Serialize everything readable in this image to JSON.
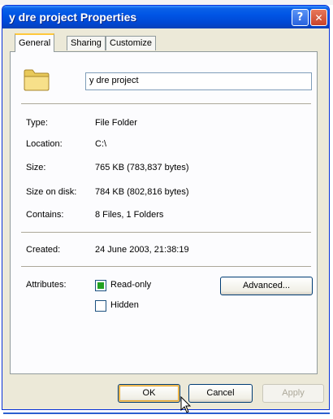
{
  "window": {
    "title": "y dre project Properties",
    "help_label": "?",
    "close_label": "✕"
  },
  "tabs": [
    {
      "label": "General",
      "active": true
    },
    {
      "label": "Sharing",
      "active": false
    },
    {
      "label": "Customize",
      "active": false
    }
  ],
  "general": {
    "folder_icon": "folder-icon",
    "name_value": "y dre project",
    "type_label": "Type:",
    "type_value": "File Folder",
    "location_label": "Location:",
    "location_value": "C:\\",
    "size_label": "Size:",
    "size_value": "765 KB (783,837 bytes)",
    "size_on_disk_label": "Size on disk:",
    "size_on_disk_value": "784 KB (802,816 bytes)",
    "contains_label": "Contains:",
    "contains_value": "8 Files, 1 Folders",
    "created_label": "Created:",
    "created_value": "24 June 2003, 21:38:19",
    "attributes_label": "Attributes:",
    "readonly_label": "Read-only",
    "readonly_state": "mixed",
    "hidden_label": "Hidden",
    "hidden_checked": false,
    "advanced_label": "Advanced..."
  },
  "buttons": {
    "ok": "OK",
    "cancel": "Cancel",
    "apply": "Apply"
  },
  "colors": {
    "titlebar": "#0055e5",
    "dialog_bg": "#ece9d8",
    "tab_highlight": "#ffc83c",
    "mixed_check": "#21a121"
  }
}
